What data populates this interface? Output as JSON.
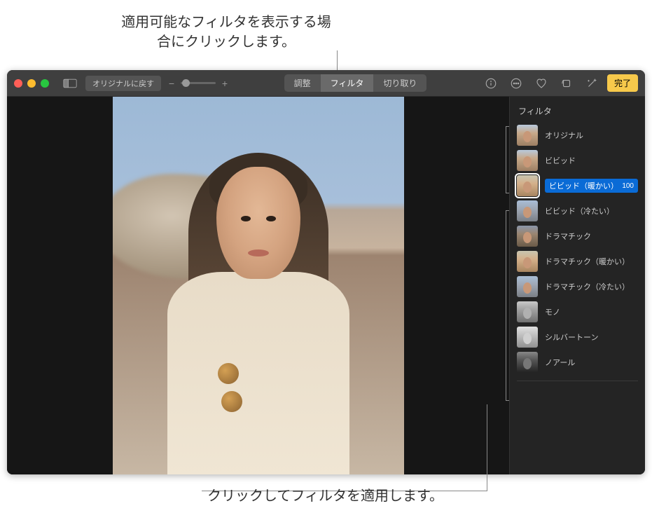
{
  "annotations": {
    "top": "適用可能なフィルタを表示する場合にクリックします。",
    "bottom": "クリックしてフィルタを適用します。"
  },
  "toolbar": {
    "revert_label": "オリジナルに戻す",
    "zoom_minus": "−",
    "zoom_plus": "+",
    "modes": {
      "adjust": "調整",
      "filters": "フィルタ",
      "crop": "切り取り"
    },
    "done_label": "完了"
  },
  "filters_panel": {
    "title": "フィルタ",
    "items": [
      {
        "label": "オリジナル",
        "selected": false,
        "tone": ""
      },
      {
        "label": "ビビッド",
        "selected": false,
        "tone": ""
      },
      {
        "label": "ビビッド（暖かい）",
        "selected": true,
        "tone": "ft-warm",
        "value": "100"
      },
      {
        "label": "ビビッド（冷たい）",
        "selected": false,
        "tone": "ft-cool"
      },
      {
        "label": "ドラマチック",
        "selected": false,
        "tone": "ft-dramatic"
      },
      {
        "label": "ドラマチック（暖かい）",
        "selected": false,
        "tone": "ft-warm"
      },
      {
        "label": "ドラマチック（冷たい）",
        "selected": false,
        "tone": "ft-cool"
      },
      {
        "label": "モノ",
        "selected": false,
        "tone": "ft-mono"
      },
      {
        "label": "シルバートーン",
        "selected": false,
        "tone": "ft-silver"
      },
      {
        "label": "ノアール",
        "selected": false,
        "tone": "ft-noir"
      }
    ]
  }
}
